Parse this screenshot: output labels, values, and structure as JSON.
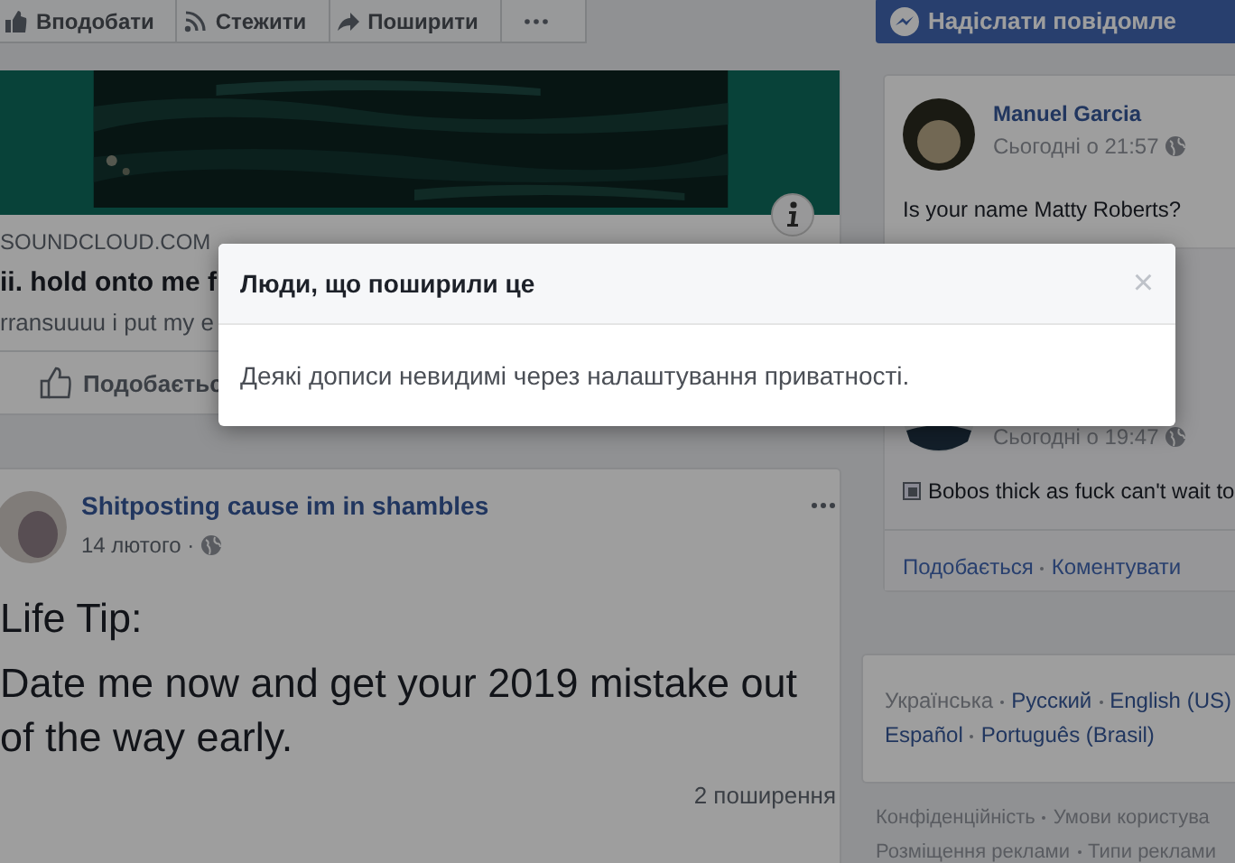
{
  "top_actions": [
    {
      "kind": "like",
      "label": "Вподобати"
    },
    {
      "kind": "follow",
      "label": "Стежити"
    },
    {
      "kind": "share",
      "label": "Поширити"
    },
    {
      "kind": "more"
    }
  ],
  "link_preview": {
    "domain": "SOUNDCLOUD.COM",
    "title": "ii. hold onto me f",
    "description": "rransuuuu i put my e",
    "like_label": "Подобаєтьс"
  },
  "post": {
    "author": "Shitposting cause im in shambles",
    "date": "14 лютого ·",
    "lines": [
      "Life Tip:",
      "Date me now and get your 2019 mistake out of the way early."
    ],
    "shares": "2 поширення"
  },
  "send_button": "Надіслати повідомле",
  "comments": [
    {
      "author": "Manuel Garcia",
      "time": "Сьогодні о 21:57",
      "text": "Is your name Matty Roberts?"
    },
    {
      "time": "Сьогодні о 19:47",
      "text": "Bobos thick as fuck can't wait to"
    }
  ],
  "comment_actions": [
    "Подобається",
    "Коментувати"
  ],
  "languages": [
    {
      "label": "Українська",
      "selected": true
    },
    {
      "label": "Русский",
      "selected": false
    },
    {
      "label": "English (US)",
      "selected": false
    },
    {
      "label": "Español",
      "selected": false
    },
    {
      "label": "Português (Brasil)",
      "selected": false
    }
  ],
  "footer_links": [
    [
      "Конфіденційність",
      "Умови користува"
    ],
    [
      "Розміщення реклами",
      "Типи реклами"
    ]
  ],
  "dialog": {
    "title": "Люди, що поширили це",
    "message": "Деякі дописи невидимі через налаштування приватності.",
    "close": "×"
  }
}
